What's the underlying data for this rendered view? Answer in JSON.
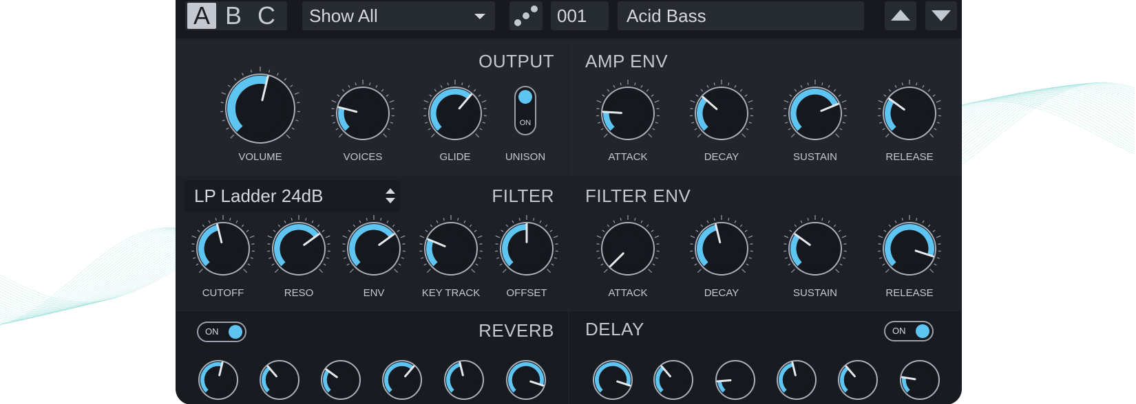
{
  "accent": "#5ec4f2",
  "topbar": {
    "slots": [
      "A",
      "B",
      "C"
    ],
    "active_slot": "A",
    "category": "Show All",
    "randomize_icon": "dice-icon",
    "preset_number": "001",
    "preset_name": "Acid Bass",
    "prev_icon": "triangle-up-icon",
    "next_icon": "triangle-down-icon"
  },
  "output": {
    "title": "OUTPUT",
    "knobs": [
      {
        "label": "VOLUME",
        "value": 0.55
      },
      {
        "label": "VOICES",
        "value": 0.22
      },
      {
        "label": "GLIDE",
        "value": 0.65
      },
      {
        "label": "UNISON",
        "toggle": "ON",
        "on": true
      }
    ]
  },
  "amp_env": {
    "title": "AMP ENV",
    "knobs": [
      {
        "label": "ATTACK",
        "value": 0.18
      },
      {
        "label": "DECAY",
        "value": 0.32
      },
      {
        "label": "SUSTAIN",
        "value": 0.75
      },
      {
        "label": "RELEASE",
        "value": 0.3
      }
    ]
  },
  "filter": {
    "title": "FILTER",
    "type": "LP Ladder 24dB",
    "knobs": [
      {
        "label": "CUTOFF",
        "value": 0.45
      },
      {
        "label": "RESO",
        "value": 0.7
      },
      {
        "label": "ENV",
        "value": 0.7
      },
      {
        "label": "KEY TRACK",
        "value": 0.25
      },
      {
        "label": "OFFSET",
        "value": 0.5
      }
    ]
  },
  "filter_env": {
    "title": "FILTER ENV",
    "knobs": [
      {
        "label": "ATTACK",
        "value": 0.0
      },
      {
        "label": "DECAY",
        "value": 0.45
      },
      {
        "label": "SUSTAIN",
        "value": 0.3
      },
      {
        "label": "RELEASE",
        "value": 0.9
      }
    ]
  },
  "reverb": {
    "title": "REVERB",
    "toggle": "ON",
    "on": true,
    "knobs": [
      0.55,
      0.35,
      0.3,
      0.65,
      0.45,
      0.9
    ]
  },
  "delay": {
    "title": "DELAY",
    "toggle": "ON",
    "on": true,
    "knobs": [
      0.9,
      0.35,
      0.15,
      0.45,
      0.35,
      0.2
    ]
  }
}
